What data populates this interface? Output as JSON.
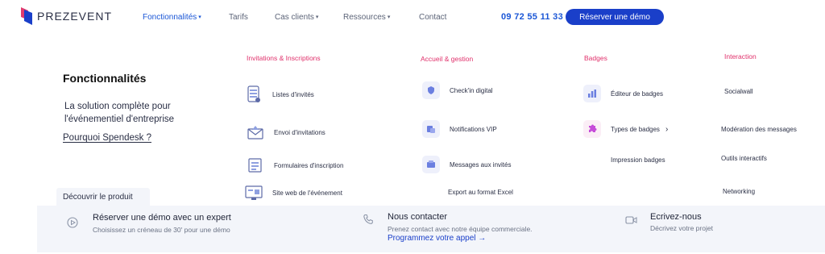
{
  "header": {
    "logo_text": "PREZEVENT",
    "nav": [
      {
        "label": "Fonctionnalités",
        "caret": "▾"
      },
      {
        "label": "Tarifs"
      },
      {
        "label": "Cas clients",
        "caret": "▾"
      },
      {
        "label": "Ressources",
        "caret": "▾"
      },
      {
        "label": "Contact"
      }
    ],
    "phone": "09 72 55 11 33",
    "cta_label": "Réserver une démo"
  },
  "panel": {
    "title": "Fonctionnalités",
    "description": "La solution complète pour l'événementiel d'entreprise",
    "link": "Pourquoi Spendesk ?",
    "discover": "Découvrir le produit"
  },
  "columns": [
    {
      "title": "Invitations & Inscriptions",
      "items": [
        "Listes d'invités",
        "Envoi d'invitations",
        "Formulaires d'inscription",
        "Site web de l'événement"
      ]
    },
    {
      "title": "Accueil & gestion",
      "items": [
        "Check'in digital",
        "Notifications VIP",
        "Messages aux invités",
        "Export au format Excel"
      ]
    },
    {
      "title": "Badges",
      "items": [
        "Éditeur de badges",
        "Types de badges",
        "Impression badges"
      ]
    },
    {
      "title": "Interaction",
      "items": [
        "Socialwall",
        "Modération des messages",
        "Outils interactifs",
        "Networking"
      ]
    }
  ],
  "bottom": {
    "demo": {
      "title": "Réserver une démo avec un expert",
      "subtitle": "Choisissez un créneau de 30' pour une démo"
    },
    "contact": {
      "title": "Nous contacter",
      "subtitle": "Prenez contact avec notre équipe commerciale.",
      "link": "Programmez votre appel →"
    },
    "write": {
      "title": "Ecrivez-nous",
      "subtitle": "Décrivez votre projet"
    }
  },
  "colors": {
    "brand_blue": "#1a3fc9",
    "link_blue": "#1a56d6",
    "section_pink": "#e0306b",
    "icon_bg": "#eef0fb"
  }
}
